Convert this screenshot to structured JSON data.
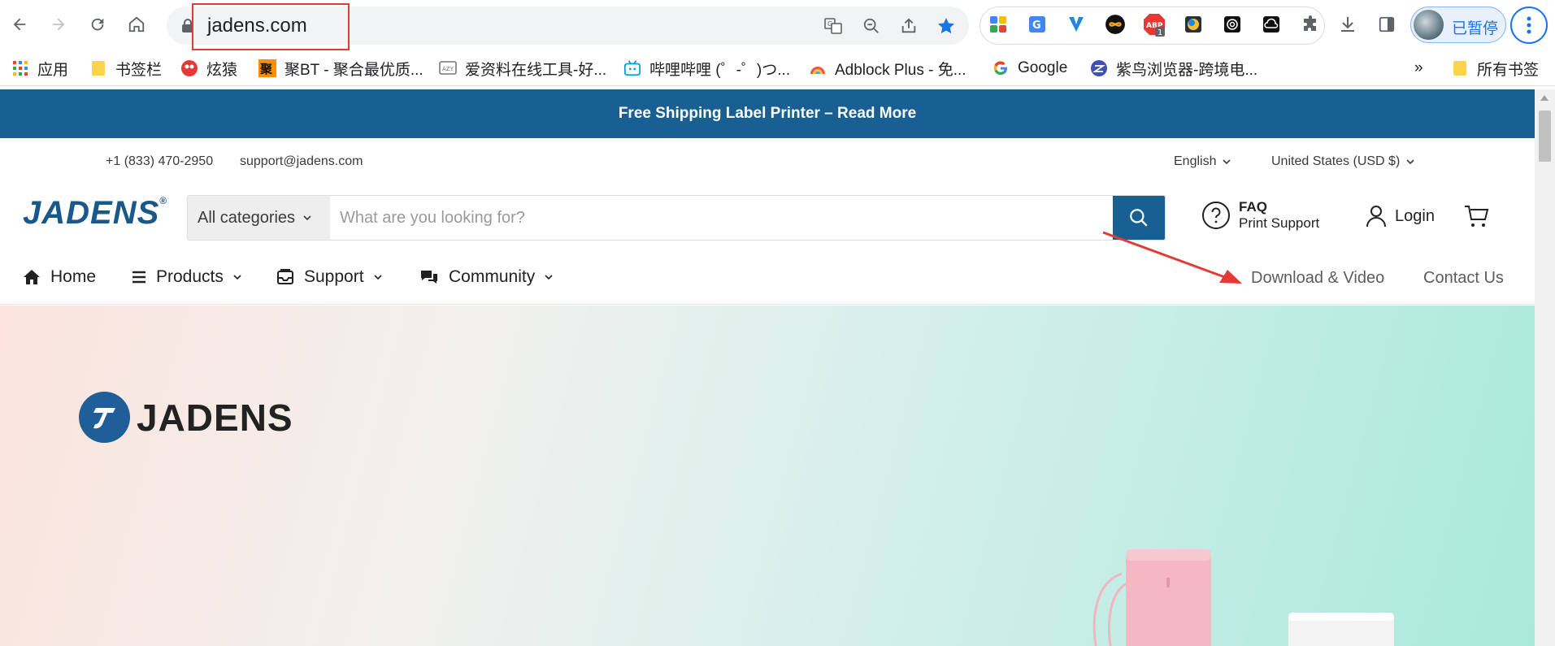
{
  "browser": {
    "url": "jadens.com",
    "profile_label": "已暂停",
    "extension_badge": "1"
  },
  "bookmarks": [
    {
      "label": "应用",
      "icon": "apps-grid-icon"
    },
    {
      "label": "书签栏",
      "icon": "folder-icon"
    },
    {
      "label": "炫猿",
      "icon": "xuanyuan-icon"
    },
    {
      "label": "聚BT - 聚合最优质...",
      "icon": "jubt-icon"
    },
    {
      "label": "爱资料在线工具-好...",
      "icon": "aizhiliao-icon"
    },
    {
      "label": "哔哩哔哩 (゜-゜)つ...",
      "icon": "bilibili-icon"
    },
    {
      "label": "Adblock Plus - 免...",
      "icon": "adblock-icon"
    },
    {
      "label": "Google",
      "icon": "google-icon"
    },
    {
      "label": "紫鸟浏览器-跨境电...",
      "icon": "ziniao-icon"
    }
  ],
  "bookmarks_more": "»",
  "bookmarks_all": "所有书签",
  "site": {
    "announcement": "Free Shipping Label Printer – Read More",
    "phone": "+1 (833) 470-2950",
    "email": "support@jadens.com",
    "language": "English",
    "currency": "United States (USD $)",
    "logo": "JADENS",
    "logo_reg": "®",
    "search_category": "All categories",
    "search_placeholder": "What are you looking for?",
    "faq_title": "FAQ",
    "faq_sub": "Print Support",
    "login": "Login",
    "nav": {
      "home": "Home",
      "products": "Products",
      "support": "Support",
      "community": "Community",
      "download": "Download & Video",
      "contact": "Contact Us"
    },
    "hero_brand": "JADENS"
  },
  "colors": {
    "brand_blue": "#196092",
    "annotation_red": "#e53935"
  }
}
